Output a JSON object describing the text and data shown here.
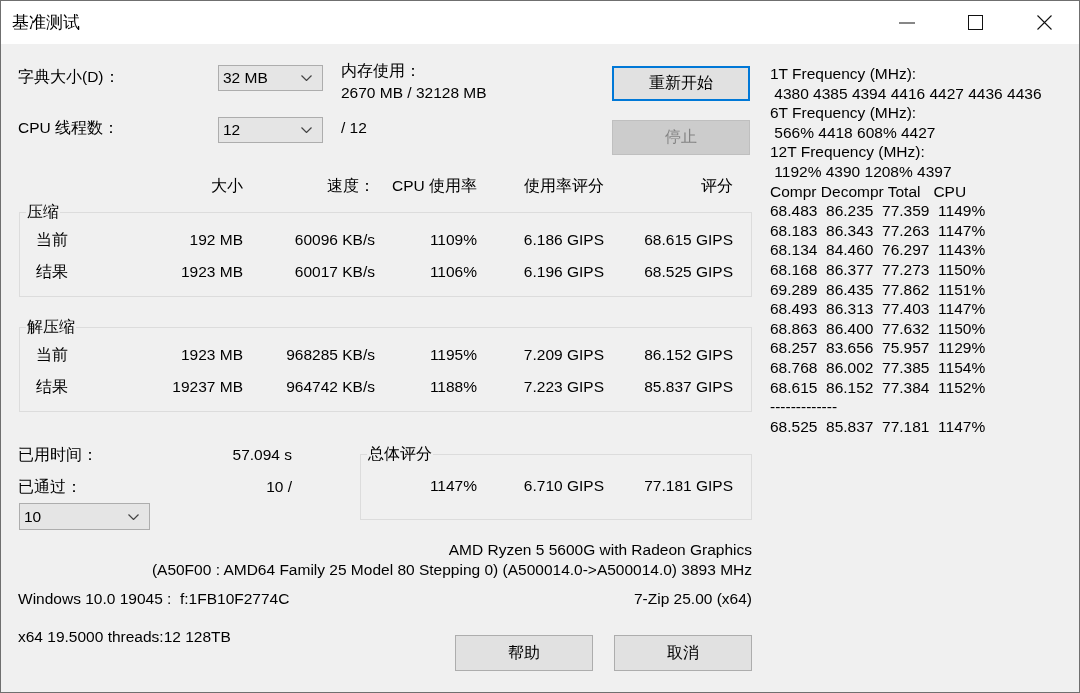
{
  "window": {
    "title": "基准测试"
  },
  "dictionary": {
    "label": "字典大小(D)：",
    "value": "32 MB"
  },
  "memory": {
    "label": "内存使用：",
    "value": "2670 MB / 32128 MB"
  },
  "threads": {
    "label": "CPU 线程数：",
    "value": "12",
    "max": "/ 12"
  },
  "actions": [
    {
      "label": "重新开始",
      "focused": true,
      "disabled": false
    },
    {
      "label": "停止",
      "focused": false,
      "disabled": true
    }
  ],
  "results": {
    "columns": [
      "大小",
      "速度：",
      "CPU 使用率",
      "使用率评分",
      "评分"
    ],
    "groups": [
      {
        "title": "压缩",
        "rows": [
          {
            "label": "当前",
            "cells": [
              "192 MB",
              "60096 KB/s",
              "1109%",
              "6.186 GIPS",
              "68.615 GIPS"
            ]
          },
          {
            "label": "结果",
            "cells": [
              "1923 MB",
              "60017 KB/s",
              "1106%",
              "6.196 GIPS",
              "68.525 GIPS"
            ]
          }
        ]
      },
      {
        "title": "解压缩",
        "rows": [
          {
            "label": "当前",
            "cells": [
              "1923 MB",
              "968285 KB/s",
              "1195%",
              "7.209 GIPS",
              "86.152 GIPS"
            ]
          },
          {
            "label": "结果",
            "cells": [
              "19237 MB",
              "964742 KB/s",
              "1188%",
              "7.223 GIPS",
              "85.837 GIPS"
            ]
          }
        ]
      }
    ]
  },
  "elapsed": {
    "label": "已用时间：",
    "value": "57.094 s"
  },
  "passes": {
    "label": "已通过：",
    "value": "10 /",
    "limit": "10"
  },
  "total_rating": {
    "title": "总体评分",
    "cells": [
      "1147%",
      "6.710 GIPS",
      "77.181 GIPS"
    ]
  },
  "cpu_info": [
    "AMD Ryzen 5 5600G with Radeon Graphics",
    "(A50F00 : AMD64 Family 25 Model 80 Stepping 0) (A500014.0->A500014.0) 3893 MHz"
  ],
  "system": {
    "os": "Windows 10.0 19045 :  f:1FB10F2774C",
    "version": "7-Zip 25.00 (x64)"
  },
  "build_info": "x64 19.5000 threads:12 128TB",
  "footer_buttons": [
    "帮助",
    "取消"
  ],
  "log": [
    "1T Frequency (MHz):",
    " 4380 4385 4394 4416 4427 4436 4436",
    "6T Frequency (MHz):",
    " 566% 4418 608% 4427",
    "12T Frequency (MHz):",
    " 1192% 4390 1208% 4397",
    "Compr Decompr Total   CPU",
    "68.483  86.235  77.359  1149%",
    "68.183  86.343  77.263  1147%",
    "68.134  84.460  76.297  1143%",
    "68.168  86.377  77.273  1150%",
    "69.289  86.435  77.862  1151%",
    "68.493  86.313  77.403  1147%",
    "68.863  86.400  77.632  1150%",
    "68.257  83.656  75.957  1129%",
    "68.768  86.002  77.385  1154%",
    "68.615  86.152  77.384  1152%",
    "-------------",
    "68.525  85.837  77.181  1147%"
  ]
}
